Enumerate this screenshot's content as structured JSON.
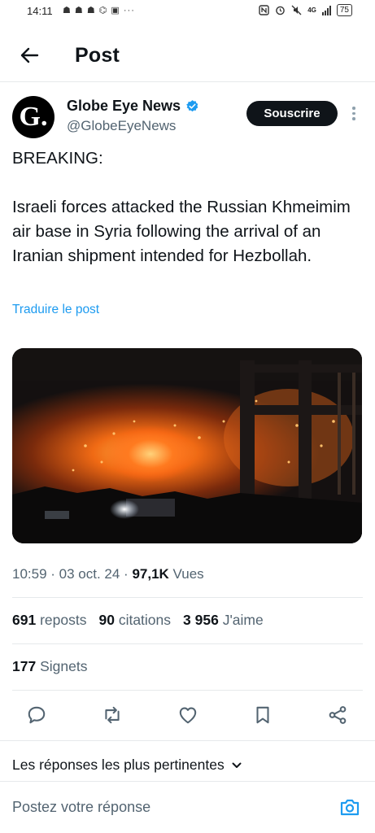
{
  "status_bar": {
    "time": "14:11",
    "notifications": "☗ ☗ ☗ ⌬ ▣ ···",
    "network": "4G",
    "battery": "75"
  },
  "header": {
    "back_icon": "arrow-left-icon",
    "title": "Post"
  },
  "author": {
    "avatar_letter": "G.",
    "name": "Globe Eye News",
    "handle": "@GlobeEyeNews",
    "verified_color": "#1d9bf0",
    "subscribe_label": "Souscrire"
  },
  "tweet": {
    "line1": "BREAKING:",
    "body": "Israeli forces attacked the Russian Khmeimim air base in Syria following the arrival of an Iranian shipment intended for Hezbollah.",
    "translate_label": "Traduire le post"
  },
  "meta": {
    "time": "10:59",
    "date": "03 oct. 24",
    "views_count": "97,1K",
    "views_label": "Vues"
  },
  "stats": {
    "reposts_count": "691",
    "reposts_label": "reposts",
    "quotes_count": "90",
    "quotes_label": "citations",
    "likes_count": "3 956",
    "likes_label": "J'aime",
    "bookmarks_count": "177",
    "bookmarks_label": "Signets"
  },
  "actions": [
    "reply-icon",
    "repost-icon",
    "like-icon",
    "bookmark-icon",
    "share-icon"
  ],
  "replies": {
    "sort_label": "Les réponses les plus pertinentes",
    "input_placeholder": "Postez votre réponse"
  },
  "colors": {
    "accent": "#1d9bf0",
    "text": "#0f1419",
    "secondary": "#536471"
  }
}
